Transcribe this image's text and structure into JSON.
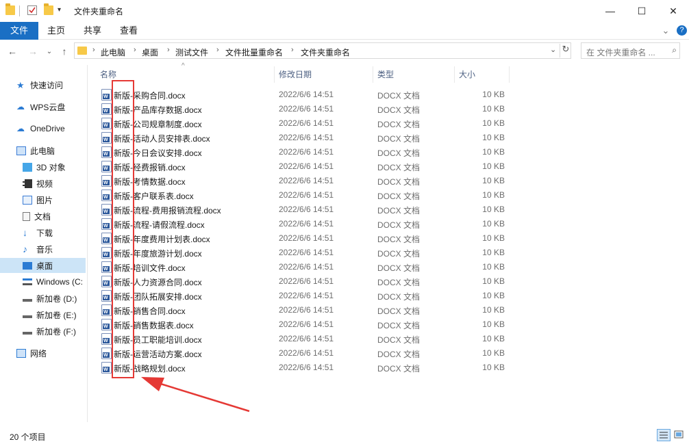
{
  "window": {
    "title": "文件夹重命名",
    "minimize": "—",
    "maximize": "☐",
    "close": "✕"
  },
  "ribbon": {
    "tabs": [
      "文件",
      "主页",
      "共享",
      "查看"
    ],
    "expand_chevron": "⌄",
    "help_icon": "?"
  },
  "address": {
    "breadcrumb": [
      "此电脑",
      "桌面",
      "测试文件",
      "文件批量重命名",
      "文件夹重命名"
    ],
    "search_placeholder": "在 文件夹重命名 ..."
  },
  "nav": {
    "items": [
      {
        "label": "快速访问",
        "icon": "star-icon",
        "color": "#2b7bd3"
      },
      {
        "label": "WPS云盘",
        "icon": "cloud-icon",
        "color": "#2b7bd3"
      },
      {
        "label": "OneDrive",
        "icon": "cloud-icon",
        "color": "#2b7bd3"
      },
      {
        "label": "此电脑",
        "icon": "computer-icon",
        "color": "#3a7bd5"
      },
      {
        "label": "3D 对象",
        "icon": "cube-icon",
        "color": "#45a6e8"
      },
      {
        "label": "视频",
        "icon": "film-icon",
        "color": "#333333"
      },
      {
        "label": "图片",
        "icon": "picture-icon",
        "color": "#3a7bd5"
      },
      {
        "label": "文档",
        "icon": "document-icon",
        "color": "#777777"
      },
      {
        "label": "下载",
        "icon": "download-icon",
        "color": "#2b7bd3"
      },
      {
        "label": "音乐",
        "icon": "music-icon",
        "color": "#2b7bd3"
      },
      {
        "label": "桌面",
        "icon": "desktop-icon",
        "color": "#2b7bd3"
      },
      {
        "label": "Windows (C:",
        "icon": "drive-icon",
        "color": "#555555"
      },
      {
        "label": "新加卷 (D:)",
        "icon": "drive-icon",
        "color": "#555555"
      },
      {
        "label": "新加卷 (E:)",
        "icon": "drive-icon",
        "color": "#555555"
      },
      {
        "label": "新加卷 (F:)",
        "icon": "drive-icon",
        "color": "#555555"
      },
      {
        "label": "网络",
        "icon": "network-icon",
        "color": "#2b7bd3"
      }
    ]
  },
  "columns": [
    "名称",
    "修改日期",
    "类型",
    "大小"
  ],
  "sort_indicator": "^",
  "files": [
    {
      "name": "新版-采购合同.docx",
      "date": "2022/6/6 14:51",
      "type": "DOCX 文档",
      "size": "10 KB"
    },
    {
      "name": "新版-产品库存数据.docx",
      "date": "2022/6/6 14:51",
      "type": "DOCX 文档",
      "size": "10 KB"
    },
    {
      "name": "新版-公司规章制度.docx",
      "date": "2022/6/6 14:51",
      "type": "DOCX 文档",
      "size": "10 KB"
    },
    {
      "name": "新版-活动人员安排表.docx",
      "date": "2022/6/6 14:51",
      "type": "DOCX 文档",
      "size": "10 KB"
    },
    {
      "name": "新版-今日会议安排.docx",
      "date": "2022/6/6 14:51",
      "type": "DOCX 文档",
      "size": "10 KB"
    },
    {
      "name": "新版-经费报销.docx",
      "date": "2022/6/6 14:51",
      "type": "DOCX 文档",
      "size": "10 KB"
    },
    {
      "name": "新版-考情数据.docx",
      "date": "2022/6/6 14:51",
      "type": "DOCX 文档",
      "size": "10 KB"
    },
    {
      "name": "新版-客户联系表.docx",
      "date": "2022/6/6 14:51",
      "type": "DOCX 文档",
      "size": "10 KB"
    },
    {
      "name": "新版-流程-费用报销流程.docx",
      "date": "2022/6/6 14:51",
      "type": "DOCX 文档",
      "size": "10 KB"
    },
    {
      "name": "新版-流程-请假流程.docx",
      "date": "2022/6/6 14:51",
      "type": "DOCX 文档",
      "size": "10 KB"
    },
    {
      "name": "新版-年度费用计划表.docx",
      "date": "2022/6/6 14:51",
      "type": "DOCX 文档",
      "size": "10 KB"
    },
    {
      "name": "新版-年度旅游计划.docx",
      "date": "2022/6/6 14:51",
      "type": "DOCX 文档",
      "size": "10 KB"
    },
    {
      "name": "新版-培训文件.docx",
      "date": "2022/6/6 14:51",
      "type": "DOCX 文档",
      "size": "10 KB"
    },
    {
      "name": "新版-人力资源合同.docx",
      "date": "2022/6/6 14:51",
      "type": "DOCX 文档",
      "size": "10 KB"
    },
    {
      "name": "新版-团队拓展安排.docx",
      "date": "2022/6/6 14:51",
      "type": "DOCX 文档",
      "size": "10 KB"
    },
    {
      "name": "新版-销售合同.docx",
      "date": "2022/6/6 14:51",
      "type": "DOCX 文档",
      "size": "10 KB"
    },
    {
      "name": "新版-销售数据表.docx",
      "date": "2022/6/6 14:51",
      "type": "DOCX 文档",
      "size": "10 KB"
    },
    {
      "name": "新版-员工职能培训.docx",
      "date": "2022/6/6 14:51",
      "type": "DOCX 文档",
      "size": "10 KB"
    },
    {
      "name": "新版-运营活动方案.docx",
      "date": "2022/6/6 14:51",
      "type": "DOCX 文档",
      "size": "10 KB"
    },
    {
      "name": "新版-战略规划.docx",
      "date": "2022/6/6 14:51",
      "type": "DOCX 文档",
      "size": "10 KB"
    }
  ],
  "status": {
    "item_count": "20 个项目"
  },
  "colors": {
    "accent": "#1a6fc4",
    "selected_nav": "#cce4f7",
    "annotation": "#e53935",
    "header_text": "#4d6082"
  }
}
